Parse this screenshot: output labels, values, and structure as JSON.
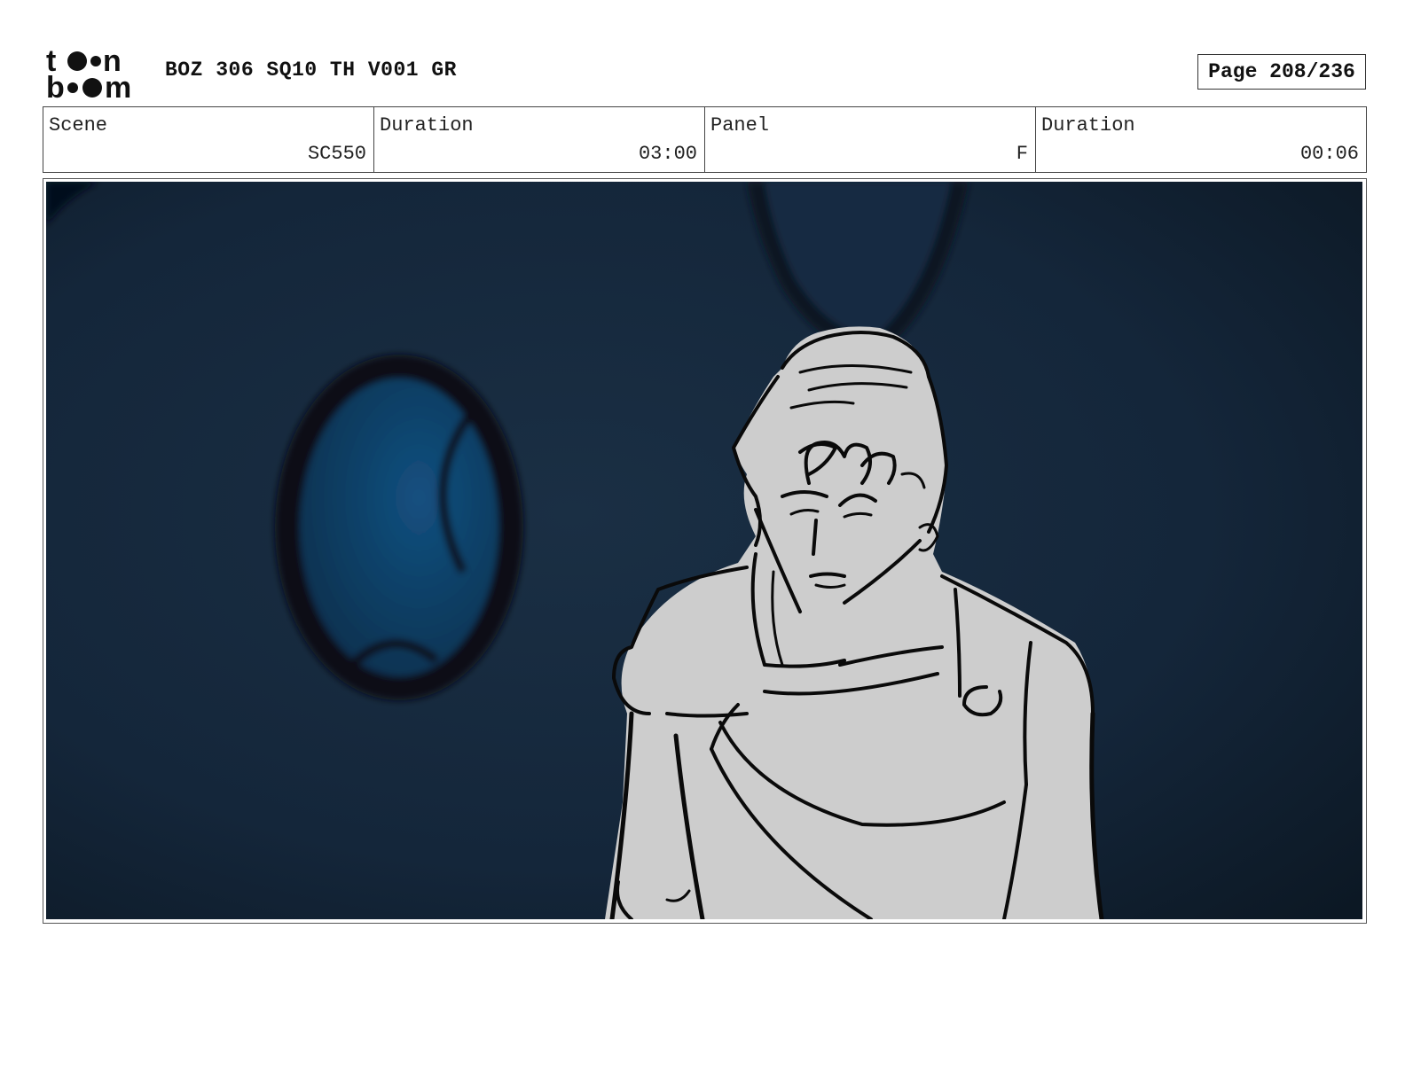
{
  "header": {
    "logo": {
      "line1": "toon",
      "line2": "boom"
    },
    "title": "BOZ 306 SQ10 TH V001 GR",
    "page": "Page 208/236"
  },
  "info": {
    "scene_label": "Scene",
    "scene_value": "SC550",
    "scene_duration_label": "Duration",
    "scene_duration_value": "03:00",
    "panel_label": "Panel",
    "panel_value": "F",
    "panel_duration_label": "Duration",
    "panel_duration_value": "00:06"
  },
  "colors": {
    "background_wall": "#16283a",
    "porthole_glass": "#0f3a5c",
    "character_fill": "#cdcdcd",
    "ink": "#0a0a0a"
  }
}
